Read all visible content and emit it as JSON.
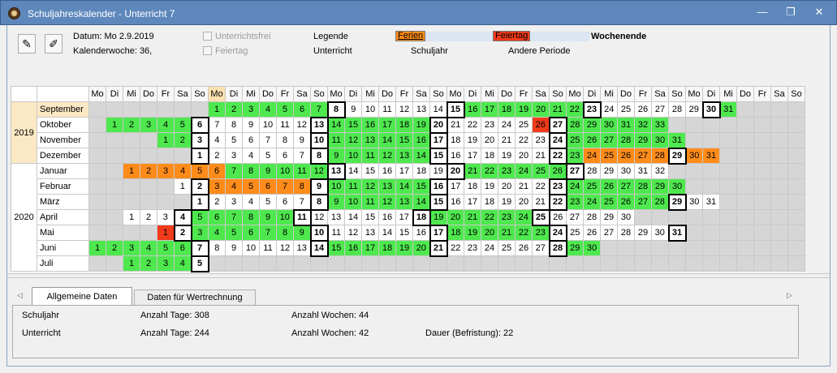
{
  "window": {
    "title": "Schuljahreskalender - Unterricht 7",
    "controls": [
      "—",
      "❐",
      "✕"
    ]
  },
  "toolbar": {
    "edit_icon": "notepad-icon",
    "settings_icon": "note-tool-icon"
  },
  "info": {
    "datum": "Datum: Mo 2.9.2019",
    "kw": "Kalenderwoche: 36,"
  },
  "filters": {
    "unterrichtsfrei": "Unterrichtsfrei",
    "feiertag": "Feiertag"
  },
  "legend": {
    "title": "Legende",
    "ferien": "Ferien",
    "feiertag": "Feiertag",
    "wochenende": "Wochenende",
    "unterricht": "Unterricht",
    "schuljahr": "Schuljahr",
    "andere_periode": "Andere Periode",
    "colors": {
      "ferien": "#ff8c1a",
      "feiertag": "#f03a1a",
      "unterricht": "#4ee84e",
      "other": "#dbe6f2"
    }
  },
  "calendar": {
    "day_headers": [
      "Mo",
      "Di",
      "Mi",
      "Do",
      "Fr",
      "Sa",
      "So",
      "Mo",
      "Di",
      "Mi",
      "Do",
      "Fr",
      "Sa",
      "So",
      "Mo",
      "Di",
      "Mi",
      "Do",
      "Fr",
      "Sa",
      "So",
      "Mo",
      "Di",
      "Mi",
      "Do",
      "Fr",
      "Sa",
      "So",
      "Mo",
      "Di",
      "Mi",
      "Do",
      "Fr",
      "Sa",
      "So",
      "Mo",
      "Di",
      "Mi",
      "Do",
      "Fr",
      "Sa",
      "So"
    ],
    "years": [
      {
        "label": "2019",
        "rows": 4
      },
      {
        "label": "2020",
        "rows": 7
      }
    ],
    "months": [
      {
        "name": "September",
        "offset": 7,
        "days": "gggggggbwwwwwwbgggggggbwwwwwwbg"
      },
      {
        "name": "Oktober",
        "offset": 1,
        "days": "gggggbwwwwwwbggggggbwwwwwrbgggggg"
      },
      {
        "name": "November",
        "offset": 4,
        "days": "ggbwwwwwwbggggggbwwwwwwbggggggg"
      },
      {
        "name": "Dezember",
        "offset": 6,
        "days": "bwwwwwwbggggggbwwwwwwbgoooooboo"
      },
      {
        "name": "Januar",
        "offset": 2,
        "days": "ooooooggggggbwwwwwwbggggggbwwwww"
      },
      {
        "name": "Februar",
        "offset": 5,
        "days": "wboooooobggggggbwwwwwwbggggggg"
      },
      {
        "name": "März",
        "offset": 6,
        "days": "bwwwwwwbggggggbwwwwwwbggggggbww"
      },
      {
        "name": "April",
        "offset": 2,
        "days": "wwwbggggggbwwwwwwbggggggbwwwww"
      },
      {
        "name": "Mai",
        "offset": 4,
        "days": "rbgggggggbwwwwwwbggggggbwwwwwwb"
      },
      {
        "name": "Juni",
        "offset": 0,
        "days": "ggggggbwwwwwwbggggggbwwwwwwbgg"
      },
      {
        "name": "Juli",
        "offset": 2,
        "days": "ggggb"
      }
    ]
  },
  "tabs": [
    {
      "label": "Allgemeine Daten",
      "active": true
    },
    {
      "label": "Daten für Wertrechnung",
      "active": false
    }
  ],
  "stats": {
    "schuljahr": "Schuljahr",
    "unterricht": "Unterricht",
    "tage_schuljahr": "Anzahl Tage: 308",
    "tage_unterricht": "Anzahl Tage: 244",
    "wochen_schuljahr": "Anzahl Wochen: 44",
    "wochen_unterricht": "Anzahl Wochen: 42",
    "dauer": "Dauer (Befristung): 22"
  }
}
